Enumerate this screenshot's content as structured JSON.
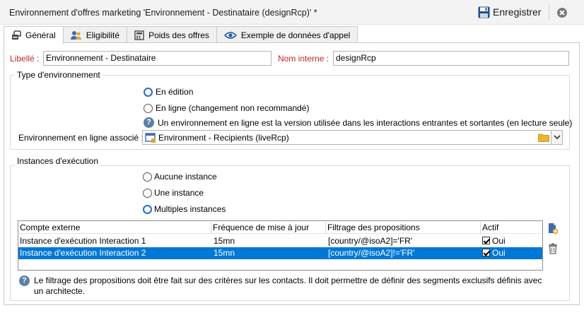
{
  "window": {
    "title": "Environnement d'offres marketing 'Environnement - Destinataire (designRcp)' *",
    "save_label": "Enregistrer"
  },
  "tabs": [
    {
      "label": "Général",
      "icon": "general-icon"
    },
    {
      "label": "Eligibilité",
      "icon": "users-icon"
    },
    {
      "label": "Poids des offres",
      "icon": "calculator-icon"
    },
    {
      "label": "Exemple de données d'appel",
      "icon": "eye-icon"
    }
  ],
  "form": {
    "label_caption": "Libellé :",
    "label_value": "Environnement - Destinataire",
    "internal_name_caption": "Nom interne :",
    "internal_name_value": "designRcp"
  },
  "env_type": {
    "title": "Type d'environnement",
    "options": [
      "En édition",
      "En ligne (changement non recommandé)"
    ],
    "selected": 0,
    "info": "Un environnement en ligne est la version utilisée dans les interactions entrantes et sortantes (en lecture seule)",
    "linked_caption": "Environnement en ligne associé :",
    "linked_value": "Environment - Recipients (liveRcp)"
  },
  "instances": {
    "title": "Instances d'exécution",
    "options": [
      "Aucune instance",
      "Une instance",
      "Multiples instances"
    ],
    "selected": 2,
    "columns": [
      "Compte externe",
      "Fréquence de mise à jour",
      "Filtrage des propositions",
      "Actif"
    ],
    "rows": [
      {
        "account": "Instance d'exécution Interaction 1",
        "frequency": "15mn",
        "filter": "[country/@isoA2]='FR'",
        "active": "Oui",
        "selected": false
      },
      {
        "account": "Instance d'exécution Interaction 2",
        "frequency": "15mn",
        "filter": "[country/@isoA2]!='FR'",
        "active": "Oui",
        "selected": true
      }
    ],
    "note": "Le filtrage des propositions doit être fait sur des critères sur les contacts.  Il doit permettre de définir des segments exclusifs définis avec un architecte."
  },
  "colors": {
    "accent": "#1e6fd0",
    "selection": "#0078d7",
    "required_label": "#c0282e"
  }
}
